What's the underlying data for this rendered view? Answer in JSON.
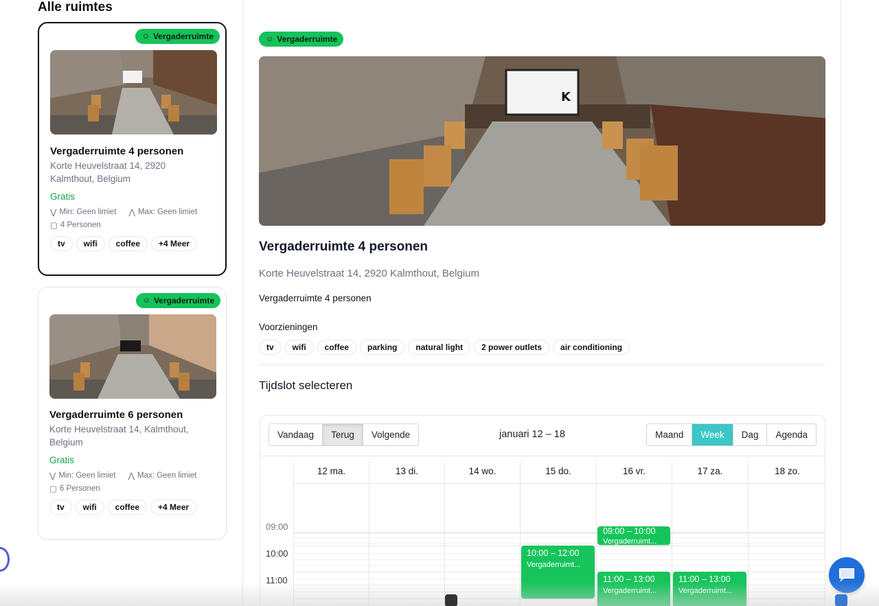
{
  "sidebar": {
    "title": "Alle ruimtes",
    "cards": [
      {
        "badge": "Vergaderruimte",
        "title": "Vergaderruimte 4 personen",
        "address": "Korte Heuvelstraat 14, 2920 Kalmthout, Belgium",
        "price": "Gratis",
        "min": "Min: Geen limiet",
        "max": "Max: Geen limiet",
        "capacity": "4 Personen",
        "amenities": [
          "tv",
          "wifi",
          "coffee",
          "+4 Meer"
        ]
      },
      {
        "badge": "Vergaderruimte",
        "title": "Vergaderruimte 6 personen",
        "address": "Korte Heuvelstraat 14, Kalmthout, Belgium",
        "price": "Gratis",
        "min": "Min: Geen limiet",
        "max": "Max: Geen limiet",
        "capacity": "6 Personen",
        "amenities": [
          "tv",
          "wifi",
          "coffee",
          "+4 Meer"
        ]
      }
    ]
  },
  "detail": {
    "badge": "Vergaderruimte",
    "title": "Vergaderruimte 4 personen",
    "address": "Korte Heuvelstraat 14, 2920 Kalmthout, Belgium",
    "description": "Vergaderruimte 4 personen",
    "facilities_label": "Voorzieningen",
    "facilities": [
      "tv",
      "wifi",
      "coffee",
      "parking",
      "natural light",
      "2 power outlets",
      "air conditioning"
    ],
    "slot_title": "Tijdslot selecteren"
  },
  "calendar": {
    "nav": [
      "Vandaag",
      "Terug",
      "Volgende"
    ],
    "range": "januari 12 – 18",
    "views": [
      "Maand",
      "Week",
      "Dag",
      "Agenda"
    ],
    "active_view": "Week",
    "days": [
      "12 ma.",
      "13 di.",
      "14 wo.",
      "15 do.",
      "16 vr.",
      "17 za.",
      "18 zo."
    ],
    "times": [
      "09:00",
      "10:00",
      "11:00"
    ],
    "events": [
      {
        "time": "09:00 – 10:00",
        "name": "Vergaderruimt..."
      },
      {
        "time": "10:00 – 12:00",
        "name": "Vergaderruimt..."
      },
      {
        "time": "11:00 – 13:00",
        "name": "Vergaderruimt..."
      },
      {
        "time": "11:00 – 13:00",
        "name": "Vergaderruimt..."
      }
    ]
  },
  "colors": {
    "accent_green": "#16c25a",
    "price_green": "#16a34a",
    "active_view": "#3cc6c6",
    "chat_blue": "#1e6fd9"
  }
}
